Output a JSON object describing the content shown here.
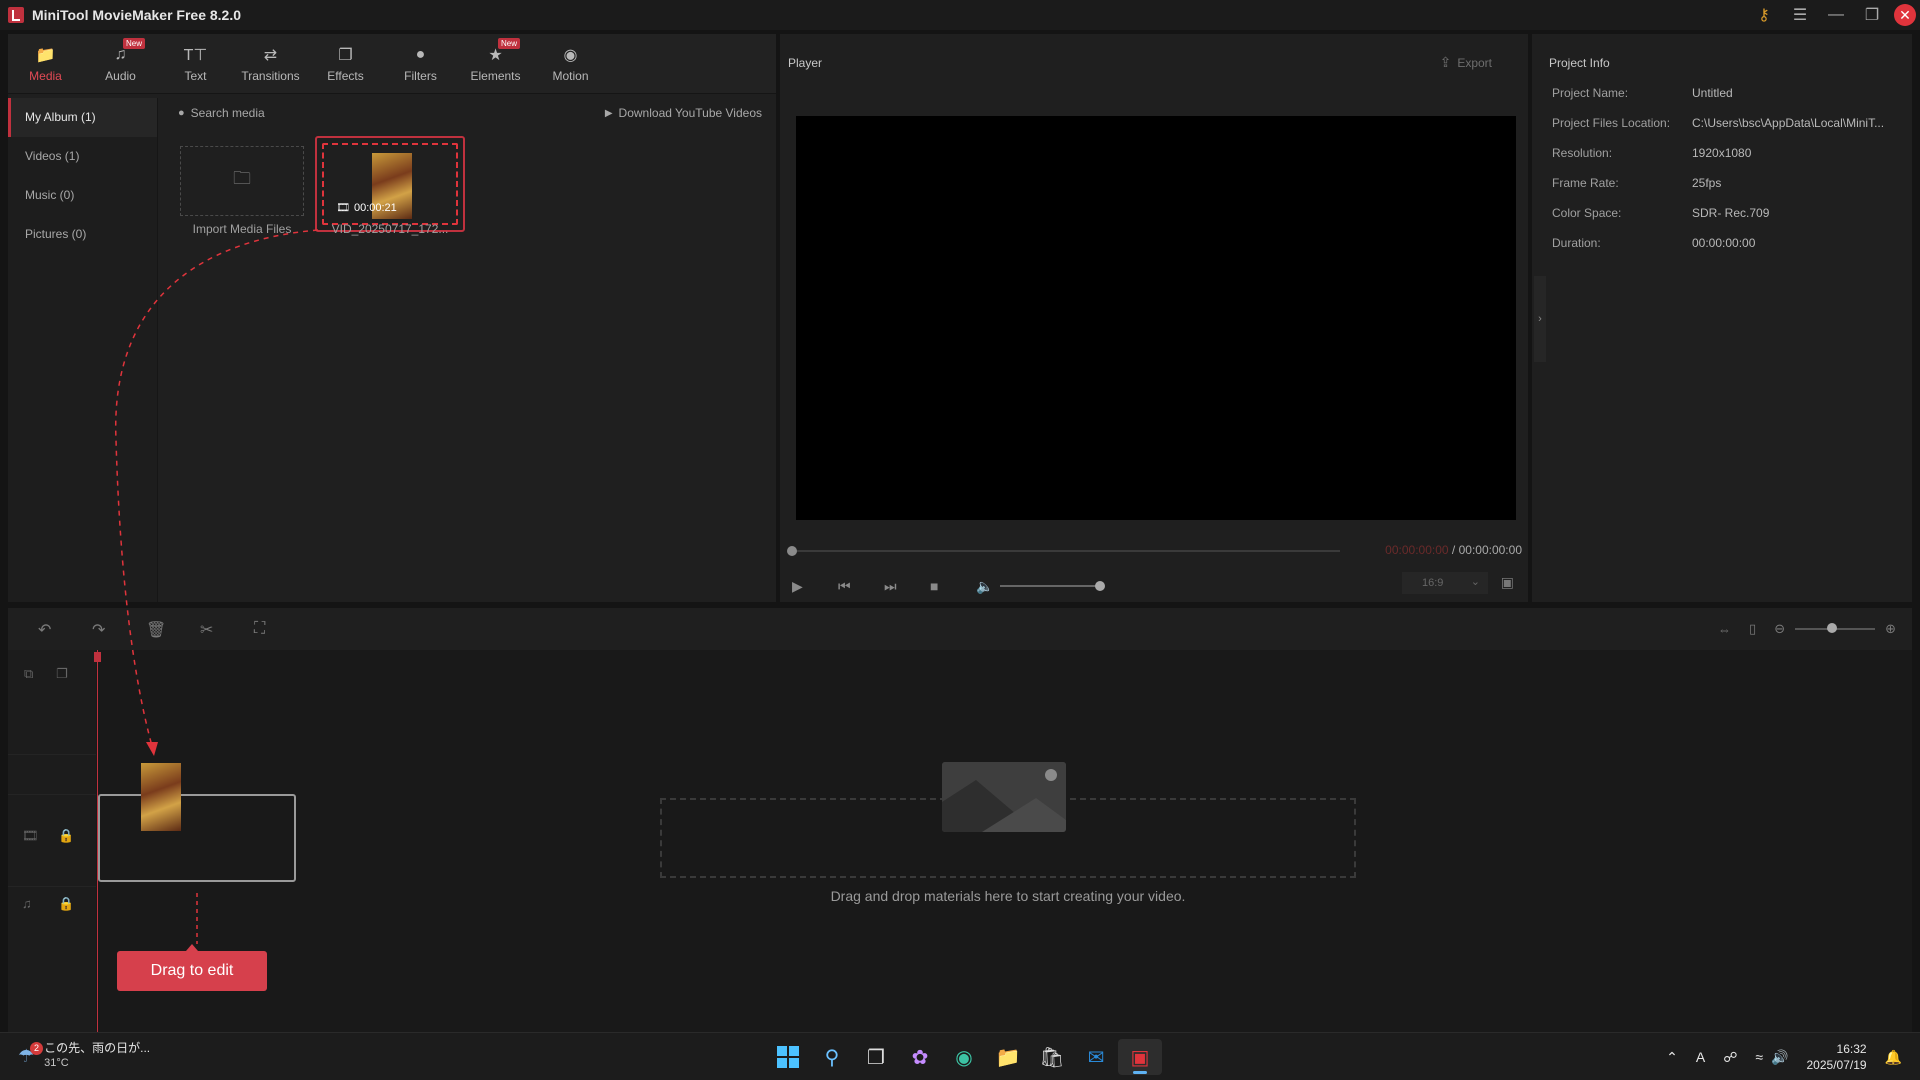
{
  "window": {
    "title": "MiniTool MovieMaker Free 8.2.0"
  },
  "toolbar": {
    "tabs": [
      {
        "label": "Media",
        "icon": "media-folder-icon",
        "active": true,
        "new": false
      },
      {
        "label": "Audio",
        "icon": "music-note-icon",
        "active": false,
        "new": true
      },
      {
        "label": "Text",
        "icon": "text-icon",
        "active": false,
        "new": false
      },
      {
        "label": "Transitions",
        "icon": "transitions-icon",
        "active": false,
        "new": false
      },
      {
        "label": "Effects",
        "icon": "effects-icon",
        "active": false,
        "new": false
      },
      {
        "label": "Filters",
        "icon": "filters-icon",
        "active": false,
        "new": false
      },
      {
        "label": "Elements",
        "icon": "elements-icon",
        "active": false,
        "new": true
      },
      {
        "label": "Motion",
        "icon": "motion-icon",
        "active": false,
        "new": false
      }
    ],
    "new_badge": "New"
  },
  "media": {
    "sidebar": [
      {
        "label": "My Album (1)",
        "active": true
      },
      {
        "label": "Videos (1)",
        "active": false
      },
      {
        "label": "Music (0)",
        "active": false
      },
      {
        "label": "Pictures (0)",
        "active": false
      }
    ],
    "search_placeholder": "Search media",
    "download_label": "Download YouTube Videos",
    "import_label": "Import Media Files",
    "clip": {
      "duration": "00:00:21",
      "name": "VID_20250717_172..."
    }
  },
  "player": {
    "title": "Player",
    "export_label": "Export",
    "current_time": "00:00:00:00",
    "separator": " / ",
    "total_time": "00:00:00:00",
    "aspect_ratio": "16:9",
    "volume_level": 1.0
  },
  "project_info": {
    "title": "Project Info",
    "rows": [
      {
        "key": "Project Name:",
        "value": "Untitled"
      },
      {
        "key": "Project Files Location:",
        "value": "C:\\Users\\bsc\\AppData\\Local\\MiniT..."
      },
      {
        "key": "Resolution:",
        "value": "1920x1080"
      },
      {
        "key": "Frame Rate:",
        "value": "25fps"
      },
      {
        "key": "Color Space:",
        "value": "SDR- Rec.709"
      },
      {
        "key": "Duration:",
        "value": "00:00:00:00"
      }
    ]
  },
  "timeline": {
    "drop_text": "Drag and drop materials here to start creating your video.",
    "drag_hint": "Drag to edit"
  },
  "taskbar": {
    "weather_text": "この先、雨の日が...",
    "temperature": "31°C",
    "notification_count": "2",
    "tray_lang": "A",
    "time": "16:32",
    "date": "2025/07/19"
  },
  "colors": {
    "accent": "#c0313e",
    "button": "#d6404c"
  }
}
